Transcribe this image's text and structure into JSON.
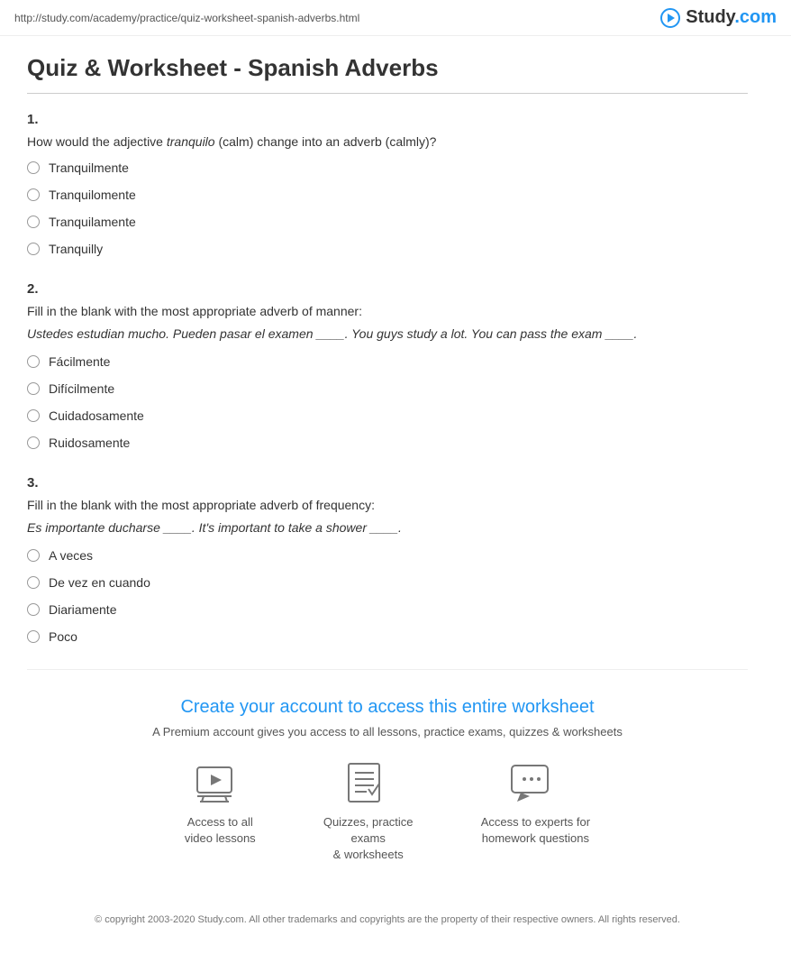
{
  "topbar": {
    "url": "http://study.com/academy/practice/quiz-worksheet-spanish-adverbs.html"
  },
  "logo": {
    "text": "Study",
    "domain": ".com"
  },
  "page": {
    "title": "Quiz & Worksheet - Spanish Adverbs"
  },
  "questions": [
    {
      "number": "1.",
      "text_prefix": "How would the adjective ",
      "text_italic": "tranquilo",
      "text_suffix": " (calm) change into an adverb (calmly)?",
      "subtitle": null,
      "subtitle2": null,
      "options": [
        "Tranquilmente",
        "Tranquilomente",
        "Tranquilamente",
        "Tranquilly"
      ]
    },
    {
      "number": "2.",
      "text_prefix": "Fill in the blank with the most appropriate adverb of manner:",
      "text_italic": null,
      "text_suffix": null,
      "subtitle": "Ustedes estudian mucho. Pueden pasar el examen ____. You guys study a lot. You can pass the exam ____.",
      "subtitle2": null,
      "options": [
        "Fácilmente",
        "Difícilmente",
        "Cuidadosamente",
        "Ruidosamente"
      ]
    },
    {
      "number": "3.",
      "text_prefix": "Fill in the blank with the most appropriate adverb of frequency:",
      "text_italic": null,
      "text_suffix": null,
      "subtitle": "Es importante ducharse ____. It's important to take a shower ____.",
      "subtitle2": null,
      "options": [
        "A veces",
        "De vez en cuando",
        "Diariamente",
        "Poco"
      ]
    }
  ],
  "cta": {
    "link_text": "Create your account to access this entire worksheet",
    "sub_text": "A Premium account gives you access to all lessons, practice exams, quizzes & worksheets",
    "features": [
      {
        "icon": "video",
        "label": "Access to all\nvideo lessons"
      },
      {
        "icon": "quiz",
        "label": "Quizzes, practice exams\n& worksheets"
      },
      {
        "icon": "expert",
        "label": "Access to experts for\nhomework questions"
      }
    ]
  },
  "footer": {
    "text": "© copyright 2003-2020 Study.com. All other trademarks and copyrights are the property of their respective owners. All rights reserved."
  }
}
